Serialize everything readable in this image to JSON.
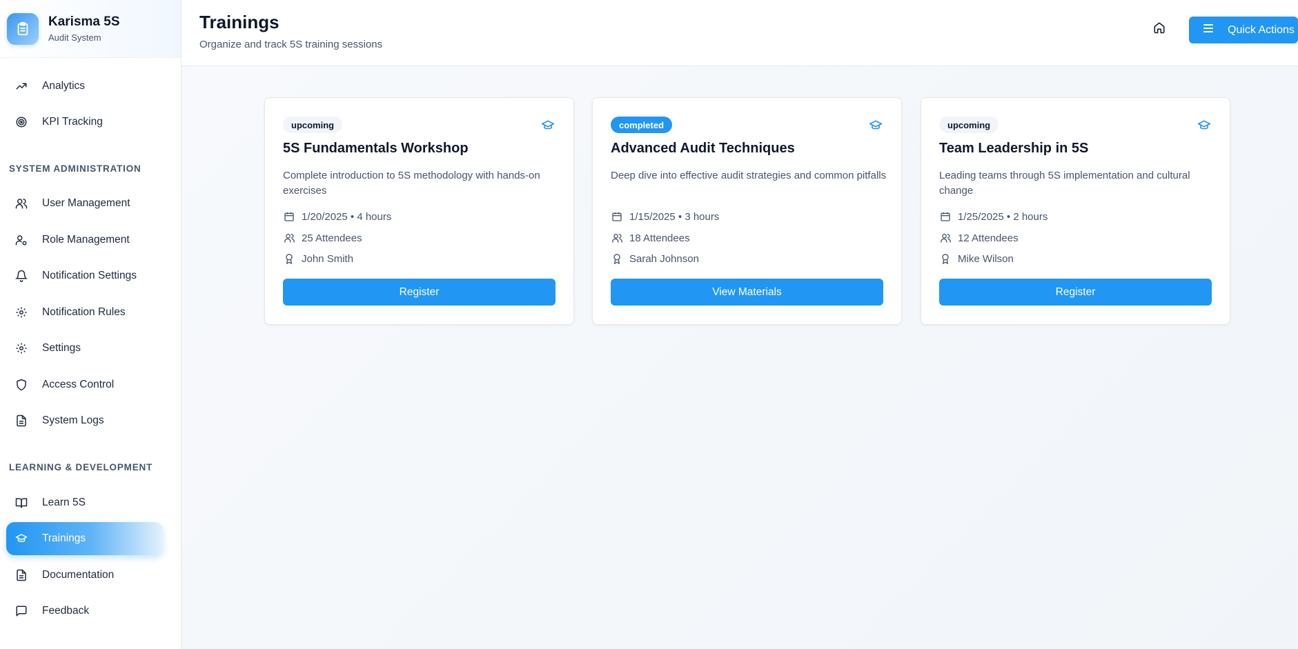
{
  "app": {
    "name": "Karisma 5S",
    "subtitle": "Audit System"
  },
  "sidebar": {
    "top_items": [
      {
        "label": "Analytics",
        "icon": "trending-up-icon"
      },
      {
        "label": "KPI Tracking",
        "icon": "target-icon"
      }
    ],
    "sections": [
      {
        "title": "SYSTEM ADMINISTRATION",
        "items": [
          {
            "label": "User Management",
            "icon": "users-icon"
          },
          {
            "label": "Role Management",
            "icon": "user-cog-icon"
          },
          {
            "label": "Notification Settings",
            "icon": "bell-icon"
          },
          {
            "label": "Notification Rules",
            "icon": "gear-icon"
          },
          {
            "label": "Settings",
            "icon": "gear-icon"
          },
          {
            "label": "Access Control",
            "icon": "shield-icon"
          },
          {
            "label": "System Logs",
            "icon": "file-text-icon"
          }
        ]
      },
      {
        "title": "LEARNING & DEVELOPMENT",
        "items": [
          {
            "label": "Learn 5S",
            "icon": "book-open-icon"
          },
          {
            "label": "Trainings",
            "icon": "graduation-cap-icon",
            "active": true
          },
          {
            "label": "Documentation",
            "icon": "file-text-icon"
          },
          {
            "label": "Feedback",
            "icon": "message-square-icon"
          }
        ]
      }
    ]
  },
  "header": {
    "title": "Trainings",
    "subtitle": "Organize and track 5S training sessions",
    "quick_actions_label": "Quick Actions"
  },
  "trainings": [
    {
      "status": "upcoming",
      "title": "5S Fundamentals Workshop",
      "description": "Complete introduction to 5S methodology with hands-on exercises",
      "schedule": "1/20/2025 • 4 hours",
      "attendees": "25 Attendees",
      "instructor": "John Smith",
      "action": "Register"
    },
    {
      "status": "completed",
      "title": "Advanced Audit Techniques",
      "description": "Deep dive into effective audit strategies and common pitfalls",
      "schedule": "1/15/2025 • 3 hours",
      "attendees": "18 Attendees",
      "instructor": "Sarah Johnson",
      "action": "View Materials"
    },
    {
      "status": "upcoming",
      "title": "Team Leadership in 5S",
      "description": "Leading teams through 5S implementation and cultural change",
      "schedule": "1/25/2025 • 2 hours",
      "attendees": "12 Attendees",
      "instructor": "Mike Wilson",
      "action": "Register"
    }
  ],
  "colors": {
    "accent": "#2196f3",
    "text": "#0f172a",
    "muted": "#475569"
  }
}
